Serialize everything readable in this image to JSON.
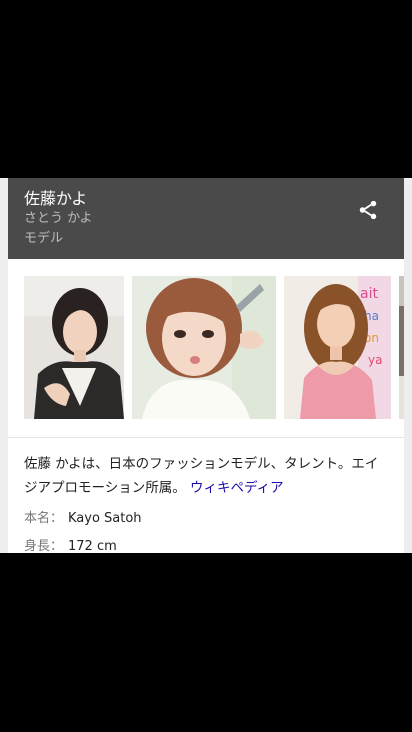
{
  "panel": {
    "title": "佐藤かよ",
    "reading": "さとう かよ",
    "subtitle": "モデル",
    "share_icon": "share-icon"
  },
  "gallery": {
    "images": [
      {
        "name": "photo-1"
      },
      {
        "name": "photo-2"
      },
      {
        "name": "photo-3"
      },
      {
        "name": "photo-4"
      }
    ]
  },
  "description": {
    "text": "佐藤 かよは、日本のファッションモデル、タレント。エイジアプロモーション所属。",
    "link": "ウィキペディア"
  },
  "facts": [
    {
      "label": "本名：",
      "value": "Kayo Satoh"
    },
    {
      "label": "身長：",
      "value": "172 cm"
    }
  ],
  "colors": {
    "header_bg": "#4a4a4a",
    "link": "#1a0dab"
  }
}
